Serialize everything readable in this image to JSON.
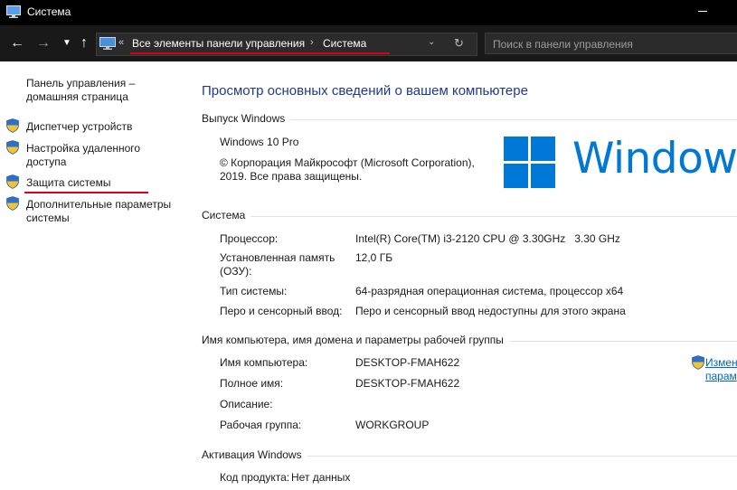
{
  "window": {
    "title": "Система"
  },
  "address_bar": {
    "overflow_glyph": "«",
    "crumbs": [
      "Все элементы панели управления",
      "Система"
    ],
    "separator": "›"
  },
  "search": {
    "placeholder": "Поиск в панели управления"
  },
  "sidebar": {
    "home_link": [
      "Панель управления –",
      "домашняя страница"
    ],
    "items": [
      {
        "label": [
          "Диспетчер устройств"
        ]
      },
      {
        "label": [
          "Настройка удаленного",
          "доступа"
        ]
      },
      {
        "label": [
          "Защита системы"
        ]
      },
      {
        "label": [
          "Дополнительные параметры",
          "системы"
        ]
      }
    ]
  },
  "main": {
    "title": "Просмотр основных сведений о вашем компьютере",
    "windows_edition": {
      "header": "Выпуск Windows",
      "edition": "Windows 10 Pro",
      "copyright": [
        "© Корпорация Майкрософт (Microsoft Corporation),",
        "2019. Все права защищены."
      ],
      "logo_text": "Windows"
    },
    "system": {
      "header": "Система",
      "rows": [
        {
          "label": [
            "Процессор:"
          ],
          "value": "Intel(R) Core(TM) i3-2120 CPU @ 3.30GHz   3.30 GHz"
        },
        {
          "label": [
            "Установленная память",
            "(ОЗУ):"
          ],
          "value": "12,0 ГБ"
        },
        {
          "label": [
            "Тип системы:"
          ],
          "value": "64-разрядная операционная система, процессор x64"
        },
        {
          "label": [
            "Перо и сенсорный ввод:"
          ],
          "value": "Перо и сенсорный ввод недоступны для этого экрана"
        }
      ]
    },
    "computer_name": {
      "header": "Имя компьютера, имя домена и параметры рабочей группы",
      "rows": [
        {
          "label": "Имя компьютера:",
          "value": "DESKTOP-FMAH622"
        },
        {
          "label": "Полное имя:",
          "value": "DESKTOP-FMAH622"
        },
        {
          "label": "Описание:",
          "value": ""
        },
        {
          "label": "Рабочая группа:",
          "value": "WORKGROUP"
        }
      ],
      "change_link": [
        "Измен",
        "парам"
      ]
    },
    "activation": {
      "header": "Активация Windows",
      "product_key_label": "Код продукта:",
      "product_key_value": "Нет данных"
    }
  },
  "colors": {
    "accent": "#0078d7",
    "annotation_red": "#d9001b",
    "title_blue": "#1e3a8a"
  }
}
